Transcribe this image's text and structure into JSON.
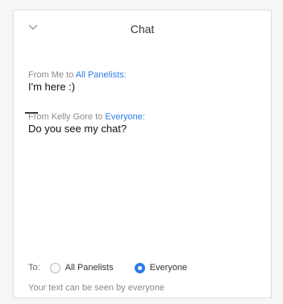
{
  "header": {
    "title": "Chat",
    "collapse_icon": "chevron-down-icon"
  },
  "messages": [
    {
      "from_prefix": "From Me to ",
      "target": "All Panelists:",
      "text": "I'm here :)"
    },
    {
      "from_prefix": "From Kelly Gore to ",
      "target": "Everyone:",
      "text": "Do you see my chat?"
    }
  ],
  "recipients": {
    "label": "To:",
    "options": [
      {
        "label": "All Panelists",
        "checked": false
      },
      {
        "label": "Everyone",
        "checked": true
      }
    ]
  },
  "composer": {
    "placeholder": "Your text can be seen by everyone"
  },
  "colors": {
    "accent": "#2b7de9"
  }
}
